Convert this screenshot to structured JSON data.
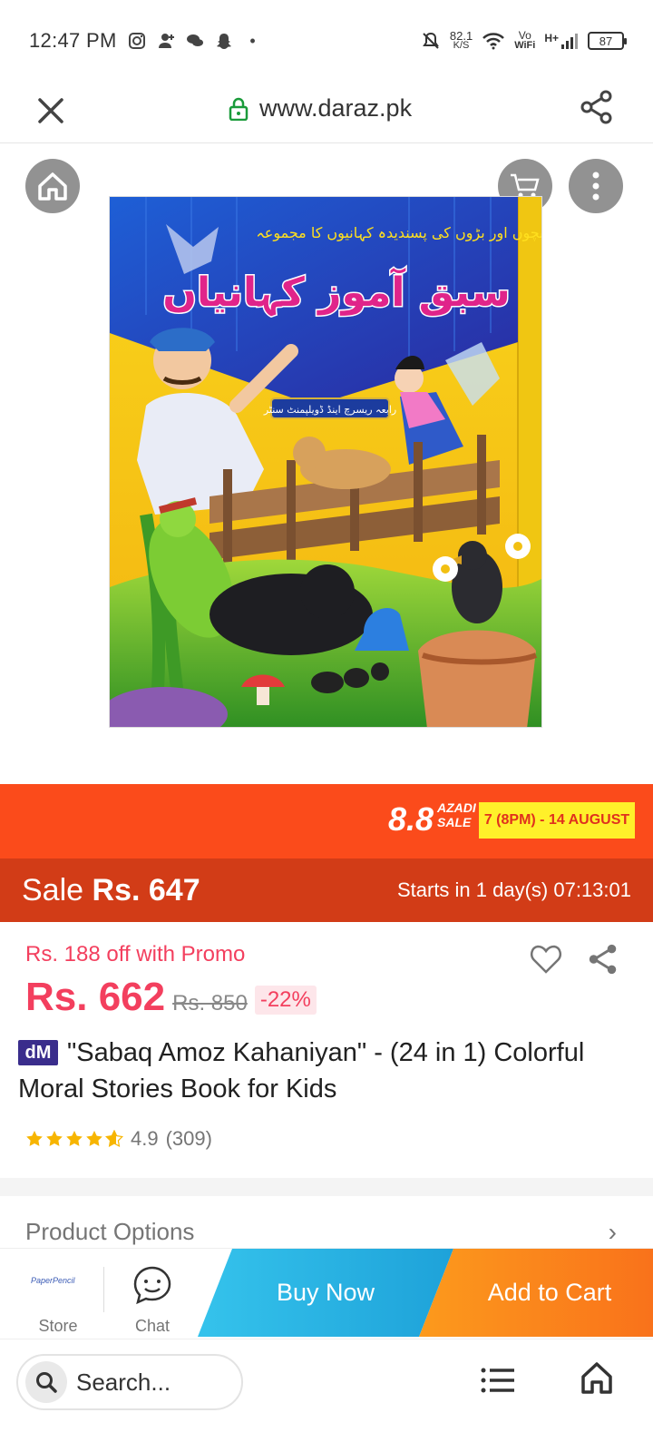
{
  "status_bar": {
    "time": "12:47 PM",
    "net_speed_value": "82.1",
    "net_speed_unit": "K/S",
    "volte_top": "Vo",
    "volte_bottom": "WiFi",
    "network": "H+",
    "battery": "87"
  },
  "browser": {
    "url": "www.daraz.pk"
  },
  "promo_banner": {
    "event_number": "8.8",
    "event_name_top": "AZADI",
    "event_name_bottom": "SALE",
    "dates": "7 (8PM) - 14 AUGUST"
  },
  "sale": {
    "label": "Sale",
    "price": "Rs. 647",
    "countdown": "Starts in 1 day(s) 07:13:01"
  },
  "product": {
    "promo_text": "Rs. 188 off with Promo",
    "price": "Rs. 662",
    "original_price": "Rs. 850",
    "discount": "-22%",
    "badge": "dM",
    "title": "\"Sabaq Amoz Kahaniyan\" - (24 in 1) Colorful Moral Stories Book for Kids",
    "rating": 4.9,
    "rating_text": "4.9",
    "reviews": "(309)"
  },
  "options": {
    "label": "Product Options",
    "chevron": "›"
  },
  "actions": {
    "store_logo": "PaperPencil",
    "store_label": "Store",
    "chat_label": "Chat",
    "buy_now": "Buy Now",
    "add_to_cart": "Add to Cart"
  },
  "bottom_bar": {
    "search_placeholder": "Search..."
  },
  "book_cover": {
    "subtitle_urdu": "بچوں اور بڑوں کی پسندیدہ کہانیوں کا مجموعہ",
    "title_urdu": "سبق آموز کہانیاں",
    "publisher_urdu": "رابعہ ریسرچ اینڈ ڈویلپمنٹ سنٹر"
  },
  "colors": {
    "brand_orange": "#fb4b1b",
    "sale_red": "#d23c17",
    "price_pink": "#f33f5e",
    "buy_now_blue": "#1ea2d9",
    "cart_orange": "#f9721b"
  }
}
